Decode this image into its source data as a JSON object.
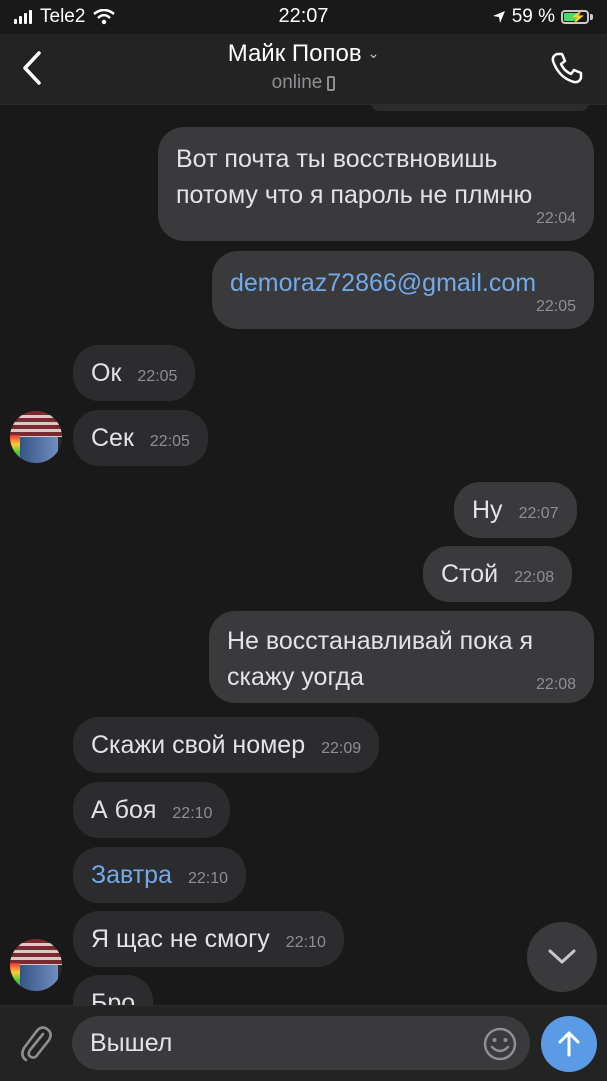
{
  "status_bar": {
    "carrier": "Tele2",
    "time": "22:07",
    "battery": "59 %"
  },
  "header": {
    "name": "Майк Попов",
    "status": "online"
  },
  "messages": [
    {
      "text": "Вот почта ты восствновишь потому что я пароль не плмню",
      "time": "22:04",
      "dir": "out"
    },
    {
      "text": "demoraz72866@gmail.com",
      "time": "22:05",
      "dir": "out",
      "link": true
    },
    {
      "text": "Ок",
      "time": "22:05",
      "dir": "in"
    },
    {
      "text": "Сек",
      "time": "22:05",
      "dir": "in"
    },
    {
      "text": "Ну",
      "time": "22:07",
      "dir": "out"
    },
    {
      "text": "Стой",
      "time": "22:08",
      "dir": "out"
    },
    {
      "text": "Не восстанавливай пока я скажу уогда",
      "time": "22:08",
      "dir": "out"
    },
    {
      "text": "Скажи свой номер",
      "time": "22:09",
      "dir": "in"
    },
    {
      "text": "А боя",
      "time": "22:10",
      "dir": "in"
    },
    {
      "text": "Завтра",
      "time": "22:10",
      "dir": "in",
      "link": true
    },
    {
      "text": "Я щас не смогу",
      "time": "22:10",
      "dir": "in"
    },
    {
      "text": "Бро",
      "time": "",
      "dir": "in"
    }
  ],
  "composer": {
    "value": "Вышел"
  },
  "colors": {
    "background": "#19191a",
    "bubble_in": "#2c2c2e",
    "bubble_out": "#3a3a3c",
    "accent": "#5b9be6",
    "link": "#71aaeb"
  },
  "icons": [
    "back-arrow-icon",
    "chevron-down-icon",
    "phone-icon",
    "attach-icon",
    "emoji-icon",
    "send-arrow-icon",
    "scroll-down-icon"
  ]
}
